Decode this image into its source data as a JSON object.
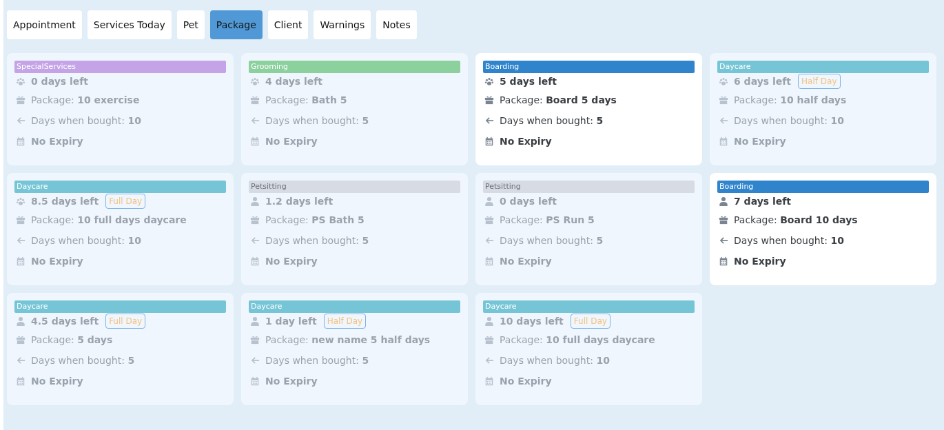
{
  "tabs": [
    {
      "label": "Appointment",
      "selected": false
    },
    {
      "label": "Services Today",
      "selected": false
    },
    {
      "label": "Pet",
      "selected": false
    },
    {
      "label": "Package",
      "selected": true
    },
    {
      "label": "Client",
      "selected": false
    },
    {
      "label": "Warnings",
      "selected": false
    },
    {
      "label": "Notes",
      "selected": false
    }
  ],
  "packages": [
    {
      "category": "SpecialServices",
      "color": "#c4a3e6",
      "active": false,
      "kind": "pet",
      "days_left": "0 days left",
      "package": "Package: **10 exercise**",
      "bought": "Days when bought: **10**",
      "expiry": "No Expiry"
    },
    {
      "category": "Grooming",
      "color": "#8bd09d",
      "active": false,
      "kind": "pet",
      "days_left": "4 days left",
      "package": "Package: **Bath 5**",
      "bought": "Days when bought: **5**",
      "expiry": "No Expiry"
    },
    {
      "category": "Boarding",
      "color": "#2f84cc",
      "active": true,
      "kind": "pet",
      "days_left": "5 days left",
      "package": "Package: **Board 5 days**",
      "bought": "Days when bought: **5**",
      "expiry": "No Expiry"
    },
    {
      "category": "Daycare",
      "color": "#76c5d6",
      "active": false,
      "kind": "pet",
      "days_left": "6 days left",
      "tag": "Half Day",
      "package": "Package: **10 half days**",
      "bought": "Days when bought: **10**",
      "expiry": "No Expiry"
    },
    {
      "category": "Daycare",
      "color": "#76c5d6",
      "active": false,
      "kind": "pet",
      "days_left": "8.5 days left",
      "tag": "Full Day",
      "package": "Package: **10 full days daycare**",
      "bought": "Days when bought: **10**",
      "expiry": "No Expiry"
    },
    {
      "category": "Petsitting",
      "color": "#d7dbe3",
      "active": false,
      "kind": "person",
      "days_left": "1.2 days left",
      "package": "Package: **PS Bath 5**",
      "bought": "Days when bought: **5**",
      "expiry": "No Expiry"
    },
    {
      "category": "Petsitting",
      "color": "#d7dbe3",
      "active": false,
      "kind": "person",
      "days_left": "0 days left",
      "package": "Package: **PS Run 5**",
      "bought": "Days when bought: **5**",
      "expiry": "No Expiry"
    },
    {
      "category": "Boarding",
      "color": "#2f84cc",
      "active": true,
      "kind": "person",
      "days_left": "7 days left",
      "package": "Package: **Board 10 days**",
      "bought": "Days when bought: **10**",
      "expiry": "No Expiry"
    },
    {
      "category": "Daycare",
      "color": "#76c5d6",
      "active": false,
      "kind": "person",
      "days_left": "4.5 days left",
      "tag": "Full Day",
      "package": "Package: **5 days**",
      "bought": "Days when bought: **5**",
      "expiry": "No Expiry"
    },
    {
      "category": "Daycare",
      "color": "#76c5d6",
      "active": false,
      "kind": "person",
      "days_left": "1 day left",
      "tag": "Half Day",
      "package": "Package: **new name 5 half days**",
      "bought": "Days when bought: **5**",
      "expiry": "No Expiry"
    },
    {
      "category": "Daycare",
      "color": "#76c5d6",
      "active": false,
      "kind": "person",
      "days_left": "10 days left",
      "tag": "Full Day",
      "package": "Package: **10 full days daycare**",
      "bought": "Days when bought: **10**",
      "expiry": "No Expiry"
    }
  ]
}
